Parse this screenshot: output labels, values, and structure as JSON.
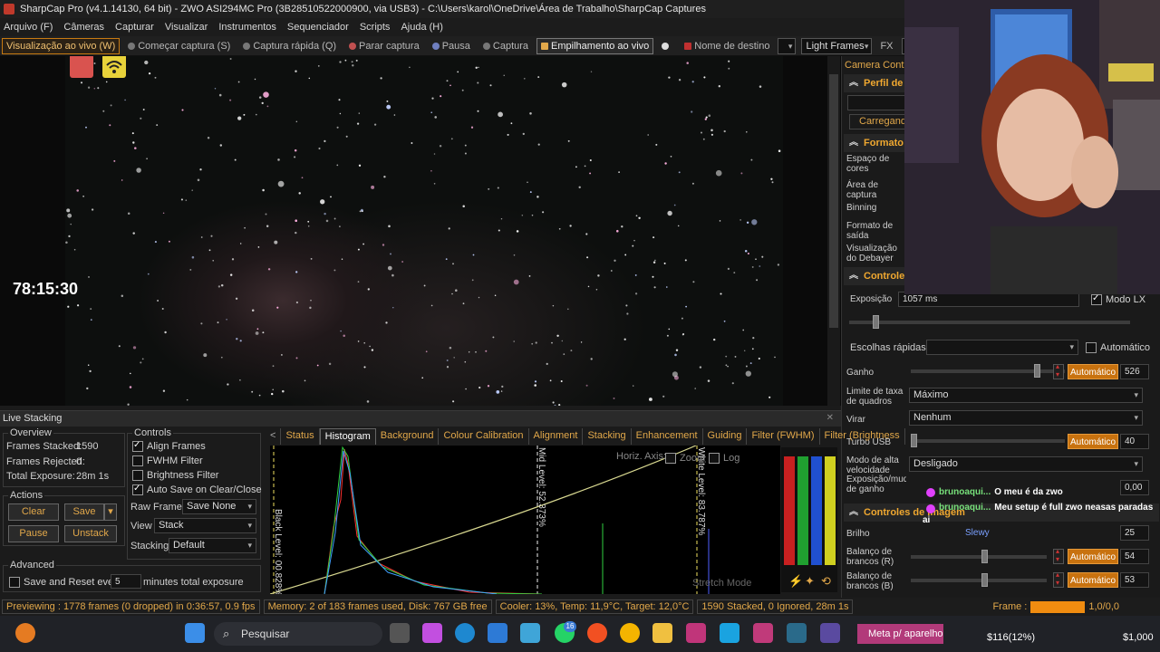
{
  "window": {
    "title": "SharpCap Pro (v4.1.14130, 64 bit) - ZWO ASI294MC Pro (3B28510522000900, via USB3) - C:\\Users\\karol\\OneDrive\\Área de Trabalho\\SharpCap Captures"
  },
  "menu": [
    "Arquivo (F)",
    "Câmeras",
    "Capturar",
    "Visualizar",
    "Instrumentos",
    "Sequenciador",
    "Scripts",
    "Ajuda (H)"
  ],
  "toolbar": {
    "live_view": "Visualização ao vivo (W)",
    "start_capture": "Começar captura (S)",
    "quick_capture": "Captura rápida (Q)",
    "stop_capture": "Parar captura",
    "pause": "Pausa",
    "capture": "Captura",
    "live_stack": "Empilhamento ao vivo",
    "target_name_label": "Nome de destino",
    "target_name_value": "",
    "frame_type": "Light Frames",
    "fx_label": "FX"
  },
  "overlay": {
    "timer": "78:15:30"
  },
  "camera_panel": {
    "title": "Camera Contro",
    "profile_header": "Perfil de C",
    "loading": "Carregando",
    "format_header": "Formato e",
    "format_labels": [
      "Espaço de cores",
      "Área de captura",
      "Binning",
      "Formato de saída",
      "Visualização do Debayer"
    ],
    "controls_header": "Controles",
    "exposure_label": "Exposição",
    "exposure_value": "1057 ms",
    "lx_mode": "Modo LX",
    "quick_choices": "Escolhas rápidas",
    "automatic_label": "Automático",
    "gain_label": "Ganho",
    "auto_button": "Automático",
    "gain_value": "526",
    "frame_rate_label": "Limite de taxa de quadros",
    "frame_rate_value": "Máximo",
    "flip_label": "Virar",
    "flip_value": "Nenhum",
    "usb_turbo_label": "Turbo USB",
    "usb_turbo_value": "40",
    "hispeed_label": "Modo de alta velocidade",
    "hispeed_value": "Desligado",
    "exposure_change_label": "Exposição/mudança de ganho",
    "exposure_change_value": "0,00",
    "image_controls_header": "Controles de Imagem",
    "brightness_label": "Brilho",
    "brightness_value": "25",
    "wb_r_label": "Balanço de brancos (R)",
    "wb_r_value": "54",
    "wb_b_label": "Balanço de brancos (B)",
    "wb_b_value": "53"
  },
  "chat": [
    {
      "user": "brunoaqui...",
      "message": "O meu é da zwo"
    },
    {
      "user": "brunoaqui...",
      "message": "Meu setup é full zwo neasas paradas ai"
    }
  ],
  "chat_overlay_name": "Slewy",
  "live_stacking": {
    "title": "Live Stacking",
    "overview_title": "Overview",
    "frames_stacked_label": "Frames Stacked:",
    "frames_stacked": "1590",
    "frames_rejected_label": "Frames Rejected:",
    "frames_rejected": "0",
    "total_exposure_label": "Total Exposure:",
    "total_exposure": "28m 1s",
    "actions_title": "Actions",
    "clear": "Clear",
    "save": "Save",
    "pause": "Pause",
    "unstack": "Unstack",
    "advanced_title": "Advanced",
    "save_reset_label": "Save and Reset every",
    "save_reset_value": "5",
    "save_reset_suffix": "minutes total exposure",
    "controls_title": "Controls",
    "align_frames": "Align Frames",
    "fwhm_filter": "FWHM Filter",
    "brightness_filter": "Brightness Filter",
    "auto_save": "Auto Save on Clear/Close",
    "raw_frames_label": "Raw Frames",
    "raw_frames_value": "Save None",
    "view_label": "View",
    "view_value": "Stack",
    "stacking_label": "Stacking",
    "stacking_value": "Default",
    "tabs": [
      "Status",
      "Histogram",
      "Background",
      "Colour Calibration",
      "Alignment",
      "Stacking",
      "Enhancement",
      "Guiding",
      "Filter (FWHM)",
      "Filter (Brightness"
    ],
    "histogram": {
      "horiz_axis": "Horiz. Axis:",
      "zoom": "Zoom",
      "log": "Log",
      "black_level": "Black Level: 00.828%",
      "mid_level": "Mid Level: 52.373%",
      "white_level": "White Level: 83.787%",
      "stretch_mode": "Stretch Mode"
    }
  },
  "statusbar": {
    "previewing": "Previewing : 1778 frames (0 dropped) in 0:36:57, 0.9 fps",
    "memory": "Memory: 2 of 183 frames used, Disk: 767 GB free",
    "cooler": "Cooler: 13%, Temp: 11,9°C, Target: 12,0°C",
    "stacked": "1590 Stacked, 0 Ignored, 28m 1s",
    "frame_label": "Frame :",
    "frame_value": "1,0/0,0"
  },
  "taskbar": {
    "search_placeholder": "Pesquisar",
    "notification_badge": "16",
    "meta_label": "Meta p/ aparelho",
    "donation_progress": "$116(12%)",
    "donation_goal": "$1,000"
  },
  "colors": {
    "accent": "#c8720f",
    "label_orange": "#e2a84a",
    "chat_green": "#77e07a"
  }
}
